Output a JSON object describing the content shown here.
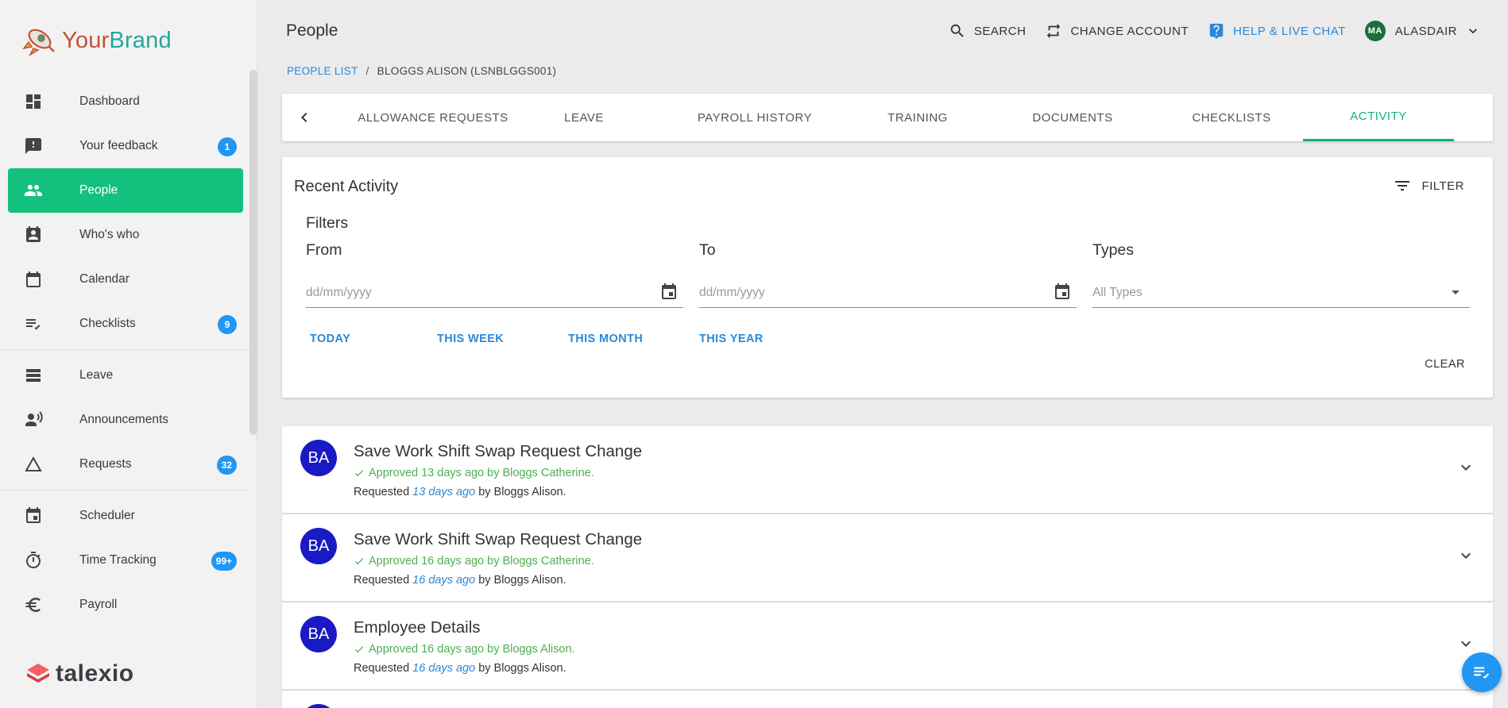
{
  "brand": {
    "name_part1": "Your",
    "name_part2": "Brand"
  },
  "footer_brand": "talexio",
  "sidebar": {
    "items": [
      {
        "label": "Dashboard",
        "icon": "dashboard-icon"
      },
      {
        "label": "Your feedback",
        "icon": "feedback-icon",
        "badge": "1"
      },
      {
        "label": "People",
        "icon": "people-icon",
        "active": true
      },
      {
        "label": "Who's who",
        "icon": "contact-card-icon"
      },
      {
        "label": "Calendar",
        "icon": "calendar-icon"
      },
      {
        "label": "Checklists",
        "icon": "checklist-icon",
        "badge": "9"
      },
      {
        "label": "Leave",
        "icon": "leave-icon"
      },
      {
        "label": "Announcements",
        "icon": "announcement-icon"
      },
      {
        "label": "Requests",
        "icon": "requests-icon",
        "badge": "32"
      },
      {
        "label": "Scheduler",
        "icon": "scheduler-icon"
      },
      {
        "label": "Time Tracking",
        "icon": "stopwatch-icon",
        "badge": "99+"
      },
      {
        "label": "Payroll",
        "icon": "euro-icon"
      }
    ]
  },
  "header": {
    "title": "People",
    "search": "SEARCH",
    "change_account": "CHANGE ACCOUNT",
    "help": "HELP & LIVE CHAT",
    "user_initials": "MA",
    "user_name": "ALASDAIR"
  },
  "breadcrumb": {
    "link": "PEOPLE LIST",
    "separator": "/",
    "current": "BLOGGS ALISON (LSNBLGGS001)"
  },
  "tabs": [
    {
      "label": "ALLOWANCE REQUESTS"
    },
    {
      "label": "LEAVE"
    },
    {
      "label": "PAYROLL HISTORY"
    },
    {
      "label": "TRAINING"
    },
    {
      "label": "DOCUMENTS"
    },
    {
      "label": "CHECKLISTS"
    },
    {
      "label": "ACTIVITY",
      "active": true
    }
  ],
  "recent": {
    "title": "Recent Activity",
    "filter_button": "FILTER",
    "filters_label": "Filters",
    "from_label": "From",
    "to_label": "To",
    "types_label": "Types",
    "from_placeholder": "dd/mm/yyyy",
    "to_placeholder": "dd/mm/yyyy",
    "types_placeholder": "All Types",
    "quick": [
      "TODAY",
      "THIS WEEK",
      "THIS MONTH",
      "THIS YEAR"
    ],
    "clear": "CLEAR"
  },
  "activities": [
    {
      "initials": "BA",
      "title": "Save Work Shift Swap Request Change",
      "status": "Approved 13 days ago by Bloggs Catherine.",
      "req_prefix": "Requested",
      "req_ago": "13 days ago",
      "req_by": "by Bloggs Alison."
    },
    {
      "initials": "BA",
      "title": "Save Work Shift Swap Request Change",
      "status": "Approved 16 days ago by Bloggs Catherine.",
      "req_prefix": "Requested",
      "req_ago": "16 days ago",
      "req_by": "by Bloggs Alison."
    },
    {
      "initials": "BA",
      "title": "Employee Details",
      "status": "Approved 16 days ago by Bloggs Alison.",
      "req_prefix": "Requested",
      "req_ago": "16 days ago",
      "req_by": "by Bloggs Alison."
    }
  ],
  "colors": {
    "accent": "#14c07e",
    "link": "#2a88d8",
    "badge": "#2196f3",
    "avatar": "#1a1ac4",
    "approved": "#4caf50"
  }
}
